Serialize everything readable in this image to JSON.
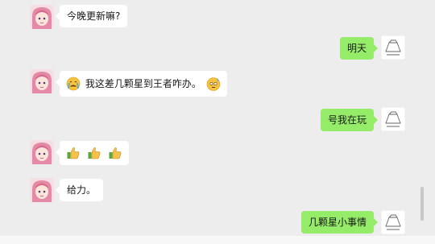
{
  "messages": [
    {
      "side": "left",
      "text": "今晚更新嘛?"
    },
    {
      "side": "right",
      "text": "明天"
    },
    {
      "side": "left",
      "text": "我这差几颗星到王者咋办。",
      "emojis": [
        "crying-face-emoji",
        "sweating-face-emoji"
      ]
    },
    {
      "side": "right",
      "text": "号我在玩"
    },
    {
      "side": "left",
      "text": "",
      "emojis": [
        "thumbs-up-emoji",
        "thumbs-up-emoji",
        "thumbs-up-emoji"
      ]
    },
    {
      "side": "left",
      "text": "给力。"
    },
    {
      "side": "right",
      "text": "几颗星小事情"
    }
  ],
  "colors": {
    "background": "#ededed",
    "bubble_left": "#ffffff",
    "bubble_right": "#95ec69"
  }
}
